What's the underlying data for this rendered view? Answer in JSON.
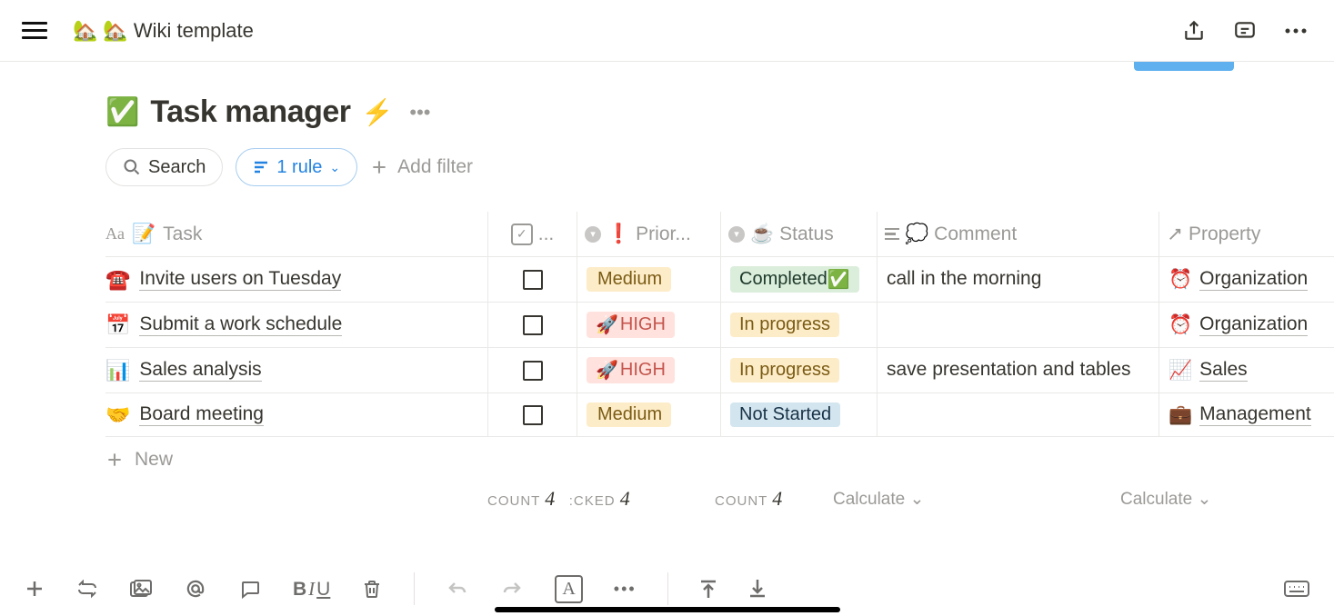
{
  "topbar": {
    "breadcrumb_emoji1": "🏡",
    "breadcrumb_emoji2": "🏡",
    "breadcrumb_text": "Wiki template"
  },
  "page": {
    "title_emoji": "✅",
    "title_text": "Task manager",
    "bolt": "⚡"
  },
  "filters": {
    "search_label": "Search",
    "rule_label": "1 rule",
    "add_filter_label": "Add filter"
  },
  "columns": {
    "task": "Task",
    "task_icon": "📝",
    "check_dots": "...",
    "priority_emoji": "❗",
    "priority": "Prior...",
    "status_emoji": "☕",
    "status": "Status",
    "comment_emoji": "💭",
    "comment": "Comment",
    "property": "Property"
  },
  "rows": [
    {
      "emoji": "☎️",
      "task": "Invite users on Tuesday",
      "priority_tag": "Medium",
      "priority_class": "medium",
      "priority_emoji": "",
      "status_tag": "Completed",
      "status_class": "completed",
      "status_suffix": "✅",
      "comment": "call in the morning",
      "prop_emoji": "⏰",
      "property": "Organization"
    },
    {
      "emoji": "📅",
      "task": "Submit a work schedule",
      "priority_tag": "HIGH",
      "priority_class": "high",
      "priority_emoji": "🚀",
      "status_tag": "In progress",
      "status_class": "inprogress",
      "status_suffix": "",
      "comment": "",
      "prop_emoji": "⏰",
      "property": "Organization"
    },
    {
      "emoji": "📊",
      "task": "Sales analysis",
      "priority_tag": "HIGH",
      "priority_class": "high",
      "priority_emoji": "🚀",
      "status_tag": "In progress",
      "status_class": "inprogress",
      "status_suffix": "",
      "comment": "save presentation and tables",
      "prop_emoji": "📈",
      "property": "Sales"
    },
    {
      "emoji": "🤝",
      "task": "Board meeting",
      "priority_tag": "Medium",
      "priority_class": "medium",
      "priority_emoji": "",
      "status_tag": "Not Started",
      "status_class": "notstarted",
      "status_suffix": "",
      "comment": "",
      "prop_emoji": "💼",
      "property": "Management"
    }
  ],
  "newrow_label": "New",
  "footer": {
    "count_label1": "COUNT",
    "count_val1": "4",
    "count_label1b": ":CKED",
    "count_val1b": "4",
    "count_label2": "COUNT",
    "count_val2": "4",
    "calc": "Calculate"
  },
  "bottombar": {
    "b": "B",
    "i": "I",
    "u": "U",
    "a": "A",
    "dots": "•••"
  }
}
